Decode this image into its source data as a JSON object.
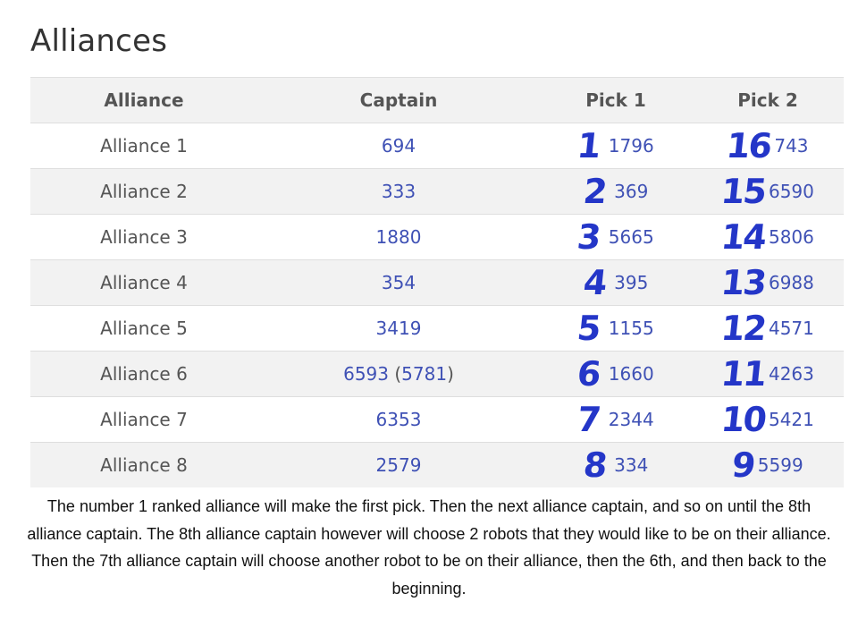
{
  "page": {
    "title": "Alliances"
  },
  "table": {
    "headers": {
      "alliance": "Alliance",
      "captain": "Captain",
      "pick1": "Pick 1",
      "pick2": "Pick 2"
    },
    "rows": [
      {
        "alliance": "Alliance 1",
        "captain": "694",
        "captain_backup": "",
        "pick1_order": "1",
        "pick1": "1796",
        "pick2_order": "16",
        "pick2": "743"
      },
      {
        "alliance": "Alliance 2",
        "captain": "333",
        "captain_backup": "",
        "pick1_order": "2",
        "pick1": "369",
        "pick2_order": "15",
        "pick2": "6590"
      },
      {
        "alliance": "Alliance 3",
        "captain": "1880",
        "captain_backup": "",
        "pick1_order": "3",
        "pick1": "5665",
        "pick2_order": "14",
        "pick2": "5806"
      },
      {
        "alliance": "Alliance 4",
        "captain": "354",
        "captain_backup": "",
        "pick1_order": "4",
        "pick1": "395",
        "pick2_order": "13",
        "pick2": "6988"
      },
      {
        "alliance": "Alliance 5",
        "captain": "3419",
        "captain_backup": "",
        "pick1_order": "5",
        "pick1": "1155",
        "pick2_order": "12",
        "pick2": "4571"
      },
      {
        "alliance": "Alliance 6",
        "captain": "6593",
        "captain_backup": "5781",
        "pick1_order": "6",
        "pick1": "1660",
        "pick2_order": "11",
        "pick2": "4263"
      },
      {
        "alliance": "Alliance 7",
        "captain": "6353",
        "captain_backup": "",
        "pick1_order": "7",
        "pick1": "2344",
        "pick2_order": "10",
        "pick2": "5421"
      },
      {
        "alliance": "Alliance 8",
        "captain": "2579",
        "captain_backup": "",
        "pick1_order": "8",
        "pick1": "334",
        "pick2_order": "9",
        "pick2": "5599"
      }
    ]
  },
  "description": "The number 1 ranked alliance will make the first pick. Then the next alliance captain, and so on until the 8th alliance captain. The 8th alliance captain however will choose 2 robots that they would like to be on their alliance. Then the 7th alliance captain will choose another robot to be on their alliance, then the 6th, and then back to the beginning.",
  "colors": {
    "team_link": "#3f51b5",
    "handwriting": "#2436c8",
    "header_bg": "#f2f2f2"
  }
}
